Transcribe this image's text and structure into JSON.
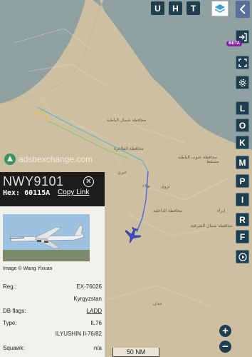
{
  "top_buttons": [
    "U",
    "H",
    "T"
  ],
  "side_buttons": {
    "beta_badge": "BETA",
    "letters": [
      "L",
      "O",
      "K",
      "M",
      "P",
      "I",
      "R",
      "F"
    ]
  },
  "watermark": "adsbexchange.com",
  "map": {
    "labels": [
      "عمان",
      "نزوى",
      "محافظة الداخلية",
      "محافظة الظاهرة",
      "محافظة شمال الباطنة",
      "محافظة جنوب الباطنة",
      "مسقط",
      "عبري",
      "بهلاء",
      "محافظة شمال الشرقية",
      "إبراء"
    ],
    "scale": "50 NM"
  },
  "aircraft": {
    "callsign": "NWY9101",
    "hex_label": "Hex:",
    "hex": "60115A",
    "copy_link": "Copy Link",
    "photo_credit": "Image © Wang Yixuan",
    "registration_label": "Reg.:",
    "registration": "EX-76026",
    "country": "Kyrgyzstan",
    "db_flags_label": "DB flags:",
    "db_flags": "LADD",
    "type_label": "Type:",
    "type": "IL76",
    "model": "ILYUSHIN Il-76/82",
    "squawk_label": "Squawk:",
    "squawk": "n/a"
  },
  "colors": {
    "button_bg": "#1e3f50",
    "beta": "#8a1da8",
    "aircraft": "#3f4dd6",
    "water": "#8fa1a0",
    "land": "#cdbf9f"
  }
}
